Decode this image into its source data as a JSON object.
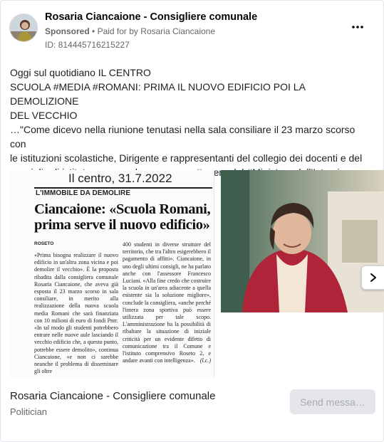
{
  "post": {
    "page_name": "Rosaria Ciancaione - Consigliere comunale",
    "sponsored": "Sponsored",
    "paid_for": "Paid for by",
    "payer": "Rosaria Ciancaione",
    "ad_id": "ID: 814445716215227",
    "more_icon": "more-horizontal-icon",
    "text_lines": [
      "Oggi sul quotidiano IL CENTRO",
      "SCUOLA #MEDIA #ROMANI: PRIMA IL NUOVO EDIFICIO POI LA DEMOLIZIONE",
      "DEL VECCHIO"
    ],
    "quote_lines": [
      "…\"Come dicevo nella riunione tenutasi nella sala consiliare il 23 marzo scorso con",
      "le istituzioni scolastiche, Dirigente e rappresentanti del collegio dei docenti e del",
      "consiglio di istituto , occorre lavorare per ottenere dal #Ministero dell'Istruzione, l…"
    ]
  },
  "clipping": {
    "date": "Il centro, 31.7.2022",
    "kicker": "L'IMMOBILE DA DEMOLIRE",
    "headline": "Ciancaione: «Scuola Romani, prima serve il nuovo edificio»",
    "subkicker": "ROSETO",
    "col1": "«Prima bisogna realizzare il nuovo edificio in un'altra zona vicina e poi demolire il vecchio». È la proposta ribadita dalla consigliera comunale Rosaria Ciancaione, che aveva già esposta il 23 marzo scorso in sala consiliare, in merito alla realizzazione della nuova scuola media Romani che sarà finanziata con 10 milioni di euro di fondi Pnrr. «In tal modo gli studenti potrebbero entrare nelle nuove aule lasciando il vecchio edificio che, a questo punto, potrebbe essere demolito», continua Ciancaione, «e non ci sarebbe neanche il problema di disseminare gli oltre",
    "col2": "400 studenti in diverse strutture del territorio, che tra l'altro esigerebbero il pagamento di affitti». Ciancaione, in uno degli ultimi consigli, ne ha parlato anche con l'assessore Francesco Luciani. «Alla fine credo che costruire la scuola in un'area adiacente a quella esistente sia la soluzione migliore», conclude la consigliera, «anche perché l'intera zona sportiva può essere utilizzata per tale scopo. L'amministrazione ha la possibilità di ribaltare la situazione di iniziale criticità per un evidente difetto di comunicazione tra il Comune e l'istituto comprensivo Roseto 2, e andare avanti con intelligenza».",
    "signature": "(l.c.)"
  },
  "carousel": {
    "next_icon": "chevron-right-icon"
  },
  "footer": {
    "name": "Rosaria Ciancaione - Consigliere comunale",
    "category": "Politician",
    "button_label": "Send messa…"
  },
  "colors": {
    "text_primary": "#1c1e21",
    "text_secondary": "#65676b",
    "button_bg": "#e4e6eb",
    "button_text": "#a8abaf",
    "jacket": "#b0243a"
  }
}
